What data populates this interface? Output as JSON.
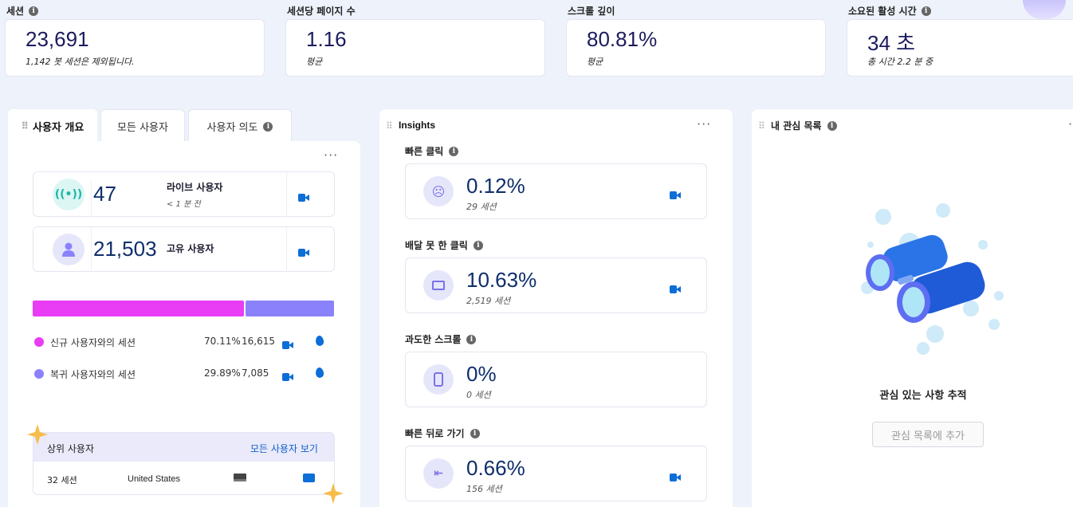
{
  "metrics": [
    {
      "label": "세션",
      "value": "23,691",
      "sub": "1,142 봇 세션은 제외됩니다."
    },
    {
      "label": "세션당 페이지 수",
      "value": "1.16",
      "sub": "평균"
    },
    {
      "label": "스크롤 깊이",
      "value": "80.81%",
      "sub": "평균"
    },
    {
      "label": "소요된 활성 시간",
      "value": "34 초",
      "sub": "총 시간 2.2 분 중"
    }
  ],
  "tabs": {
    "overview": "사용자 개요",
    "all_users": "모든 사용자",
    "intent": "사용자 의도"
  },
  "overview": {
    "live": {
      "value": "47",
      "label": "라이브 사용자",
      "sub": "< 1 분 전"
    },
    "unique": {
      "value": "21,503",
      "label": "고유 사용자"
    },
    "bar": {
      "new_fraction": 0.7011,
      "new_color": "#e83cf5",
      "returning_color": "#8b82fb"
    },
    "legend": [
      {
        "label": "신규 사용자와의 세션",
        "pct": "70.11%",
        "count": "16,615",
        "color": "#e83cf5"
      },
      {
        "label": "복귀 사용자와의 세션",
        "pct": "29.89%",
        "count": "7,085",
        "color": "#8b82fb"
      }
    ],
    "top_users": {
      "title": "상위 사용자",
      "link": "모든 사용자 보기",
      "row": {
        "sessions": "32 세션",
        "country": "United States"
      }
    }
  },
  "insights": {
    "title": "Insights",
    "items": [
      {
        "label": "빠른 클릭",
        "value": "0.12%",
        "sub": "29 세션",
        "icon": "angry-face-icon"
      },
      {
        "label": "배달 못 한 클릭",
        "value": "10.63%",
        "sub": "2,519 세션",
        "icon": "dead-click-icon"
      },
      {
        "label": "과도한 스크롤",
        "value": "0%",
        "sub": "0 세션",
        "icon": "scroll-icon"
      },
      {
        "label": "빠른 뒤로 가기",
        "value": "0.66%",
        "sub": "156 세션",
        "icon": "back-icon"
      }
    ]
  },
  "watchlist": {
    "title": "내 관심 목록",
    "empty_text": "관심 있는 사항 추적",
    "button": "관심 목록에 추가"
  }
}
